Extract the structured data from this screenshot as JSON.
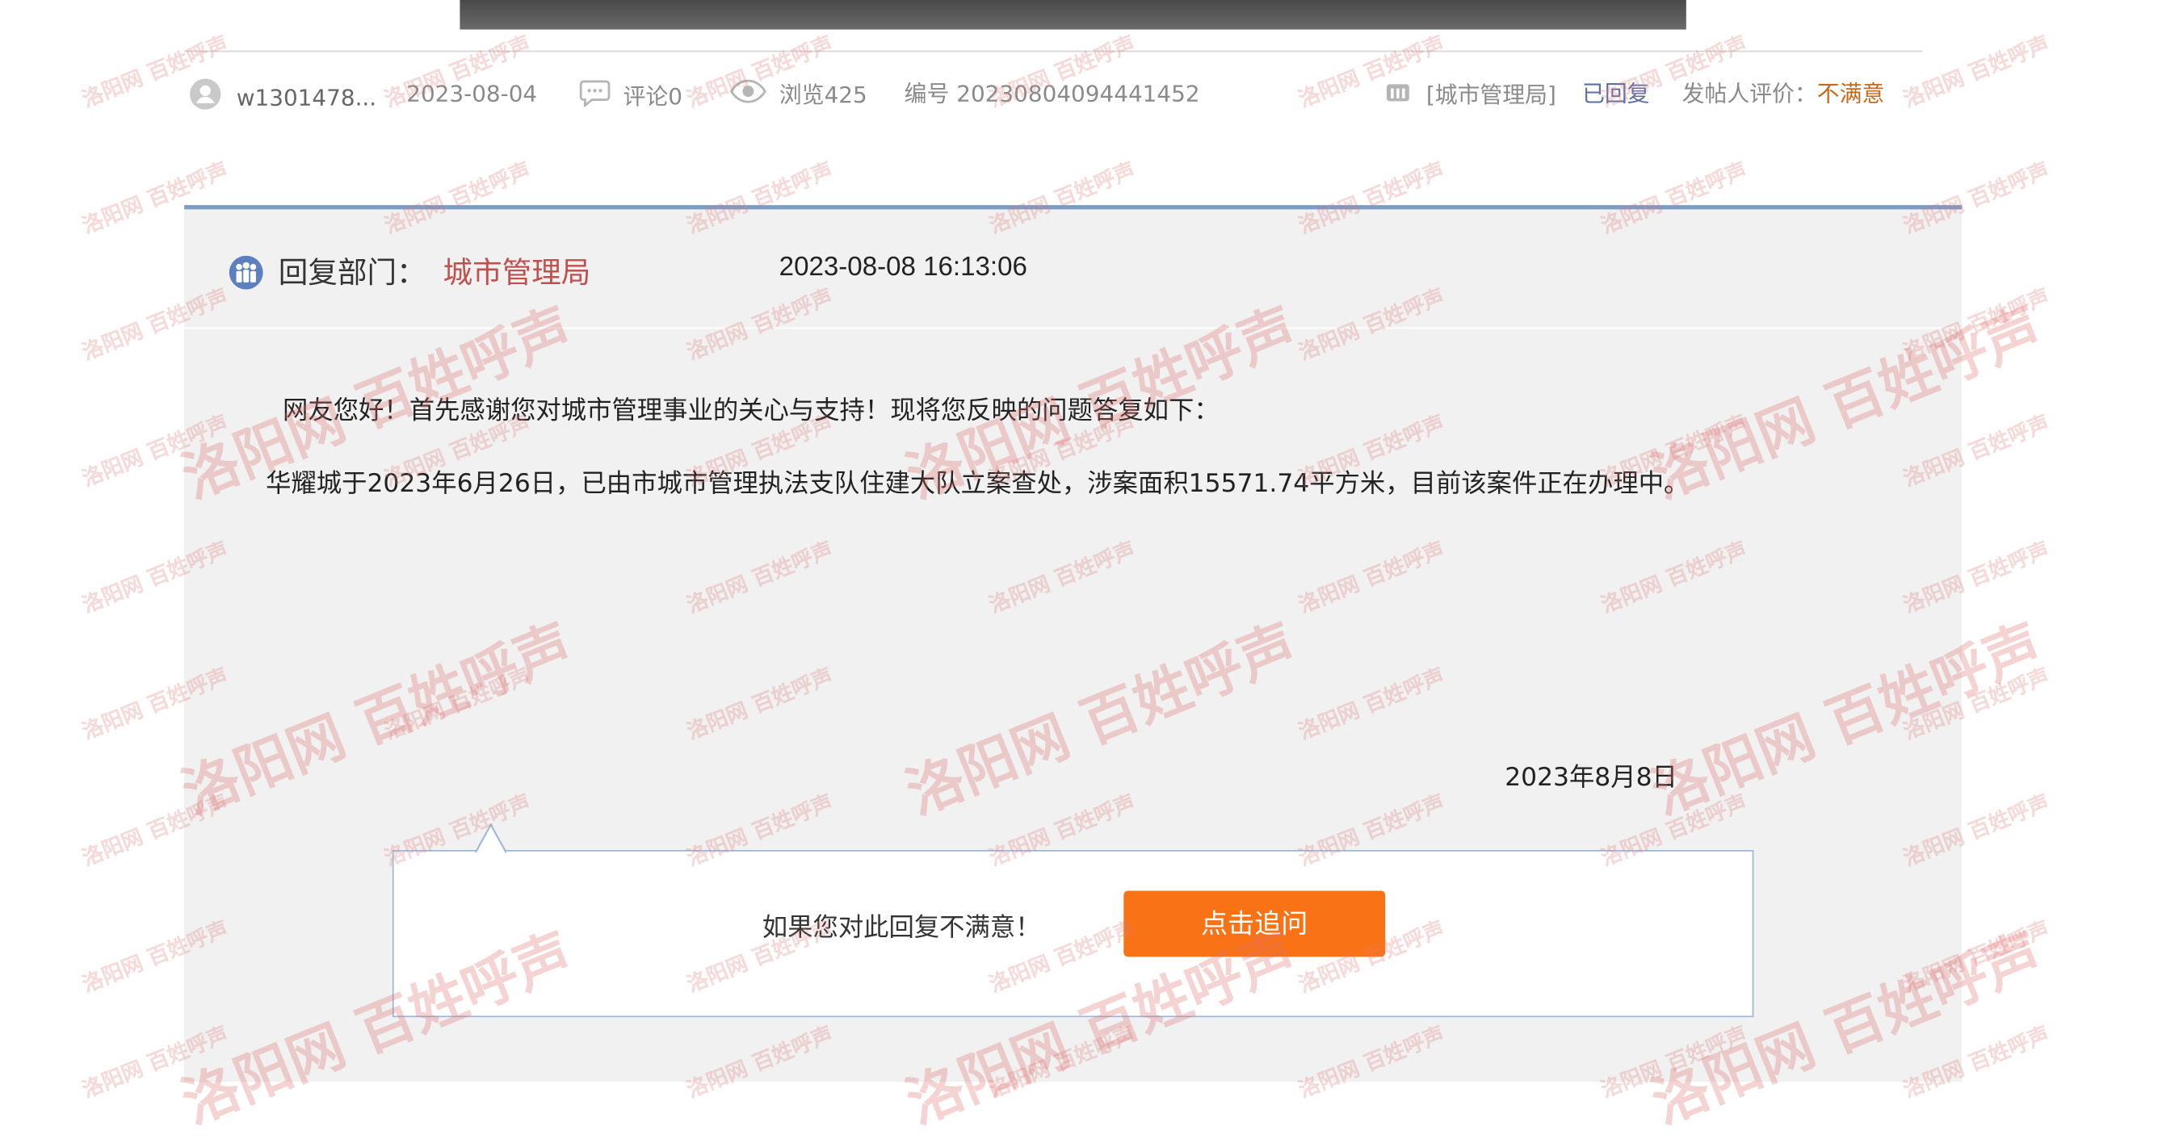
{
  "post": {
    "author": "w1301478...",
    "date": "2023-08-04",
    "comments": "评论0",
    "views": "浏览425",
    "number": "编号 20230804094441452",
    "dept_tag": "[城市管理局]",
    "status": "已回复",
    "rating_label": "发帖人评价：",
    "rating_value": "不满意"
  },
  "reply": {
    "dept_label": "回复部门：",
    "dept_name": "城市管理局",
    "time": "2023-08-08 16:13:06",
    "greeting": "网友您好！首先感谢您对城市管理事业的关心与支持！现将您反映的问题答复如下：",
    "content": "华耀城于2023年6月26日，已由市城市管理执法支队住建大队立案查处，涉案面积15571.74平方米，目前该案件正在办理中。",
    "sign_date": "2023年8月8日"
  },
  "followup": {
    "prompt": "如果您对此回复不满意！",
    "button": "点击追问"
  },
  "watermark": {
    "small": "洛阳网 百姓呼声",
    "big": "洛阳网 百姓呼声"
  },
  "colors": {
    "accent_blue": "#7a9cc6",
    "dept_red": "#c0504d",
    "button_orange": "#f97316",
    "status_blue": "#5a6fa8",
    "rating_orange": "#c86a1c"
  },
  "icons": [
    "user-icon",
    "comment-icon",
    "eye-icon",
    "department-icon"
  ]
}
